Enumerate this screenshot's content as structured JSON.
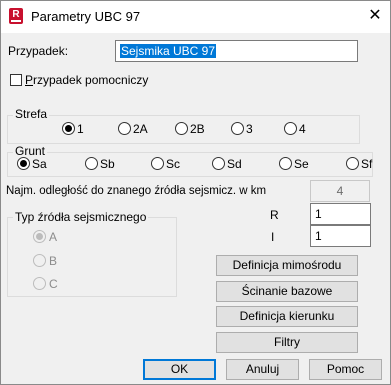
{
  "window": {
    "title": "Parametry UBC 97",
    "icon_letter": "R"
  },
  "case": {
    "label": "Przypadek:",
    "value": "Sejsmika UBC 97"
  },
  "auxiliary": {
    "label_first": "P",
    "label_rest": "rzypadek pomocniczy",
    "checked": false
  },
  "zone": {
    "title": "Strefa",
    "options": [
      "1",
      "2A",
      "2B",
      "3",
      "4"
    ],
    "selected": "1"
  },
  "soil": {
    "title": "Grunt",
    "options": [
      "Sa",
      "Sb",
      "Sc",
      "Sd",
      "Se",
      "Sf"
    ],
    "selected": "Sa"
  },
  "distance": {
    "label": "Najm. odległość do znanego źródła sejsmicz. w km",
    "value": "4"
  },
  "source_type": {
    "title": "Typ źródła sejsmicznego",
    "options": [
      "A",
      "B",
      "C"
    ],
    "selected": "A"
  },
  "r_field": {
    "label": "R",
    "value": "1"
  },
  "i_field": {
    "label": "I",
    "value": "1"
  },
  "buttons": {
    "eccentricity": "Definicja mimośrodu",
    "base_shear": "Ścinanie bazowe",
    "direction": "Definicja kierunku",
    "filters": "Filtry",
    "ok": "OK",
    "cancel": "Anuluj",
    "help": "Pomoc"
  }
}
